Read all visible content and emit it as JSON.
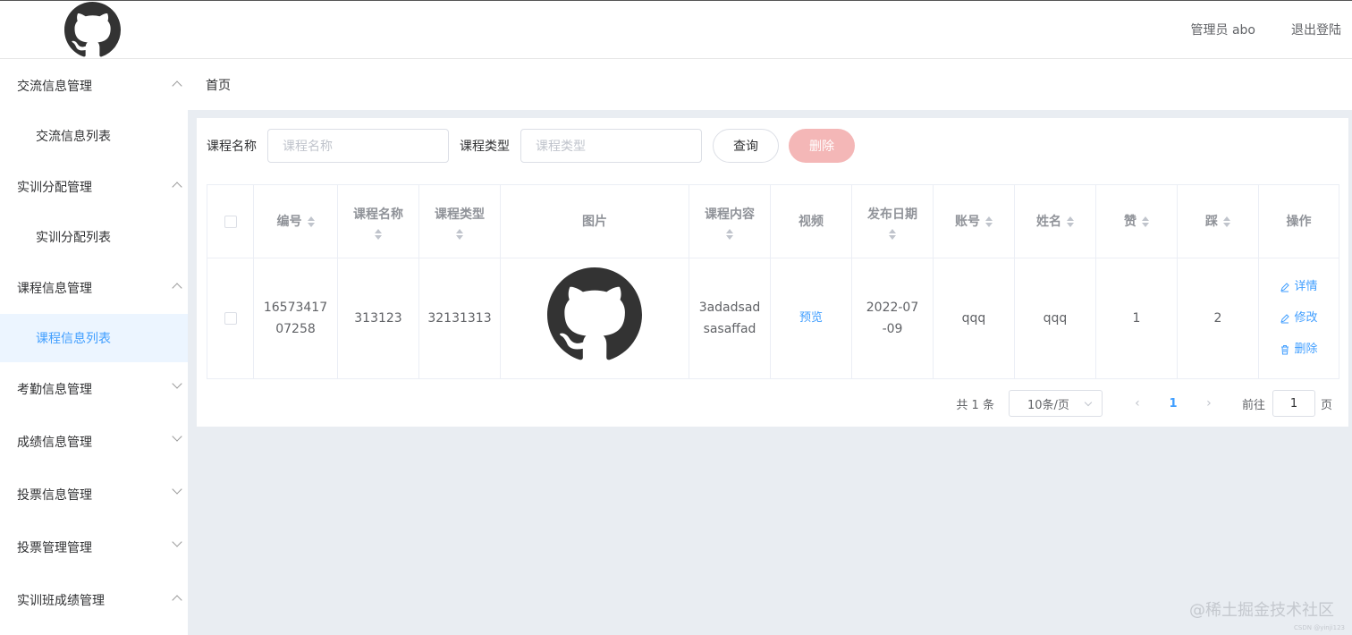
{
  "header": {
    "user_label": "管理员 abo",
    "logout_label": "退出登陆"
  },
  "sidebar": {
    "items": [
      {
        "label": "交流信息管理",
        "expanded": true,
        "children": [
          "交流信息列表"
        ]
      },
      {
        "label": "实训分配管理",
        "expanded": true,
        "children": [
          "实训分配列表"
        ]
      },
      {
        "label": "课程信息管理",
        "expanded": true,
        "children": [
          "课程信息列表"
        ]
      },
      {
        "label": "考勤信息管理",
        "expanded": false
      },
      {
        "label": "成绩信息管理",
        "expanded": false
      },
      {
        "label": "投票信息管理",
        "expanded": false
      },
      {
        "label": "投票管理管理",
        "expanded": false
      },
      {
        "label": "实训班成绩管理",
        "expanded": true
      }
    ],
    "active_item": "课程信息列表"
  },
  "breadcrumb": "首页",
  "search": {
    "name_label": "课程名称",
    "name_placeholder": "课程名称",
    "type_label": "课程类型",
    "type_placeholder": "课程类型",
    "query_button": "查询",
    "delete_button": "删除"
  },
  "table": {
    "columns": [
      "编号",
      "课程名称",
      "课程类型",
      "图片",
      "课程内容",
      "视频",
      "发布日期",
      "账号",
      "姓名",
      "赞",
      "踩",
      "操作"
    ],
    "rows": [
      {
        "id_line1": "16573417",
        "id_line2": "07258",
        "name": "313123",
        "type": "32131313",
        "image": "github-logo",
        "content_line1": "3adadsad",
        "content_line2": "sasaffad",
        "video": "预览",
        "date_line1": "2022-07",
        "date_line2": "-09",
        "account": "qqq",
        "realname": "qqq",
        "likes": "1",
        "dislikes": "2",
        "actions": [
          "详情",
          "修改",
          "删除"
        ]
      }
    ]
  },
  "pagination": {
    "total": "共 1 条",
    "page_size": "10条/页",
    "current_page": "1",
    "goto_label": "前往",
    "goto_value": "1",
    "page_suffix": "页"
  },
  "watermark": "@稀土掘金技术社区",
  "watermark_small": "CSDN @yinji123",
  "colors": {
    "accent": "#409eff",
    "danger_disabled": "#f4b7b7",
    "active_menu_bg": "#ecf5ff",
    "page_bg": "#e9edf2"
  }
}
